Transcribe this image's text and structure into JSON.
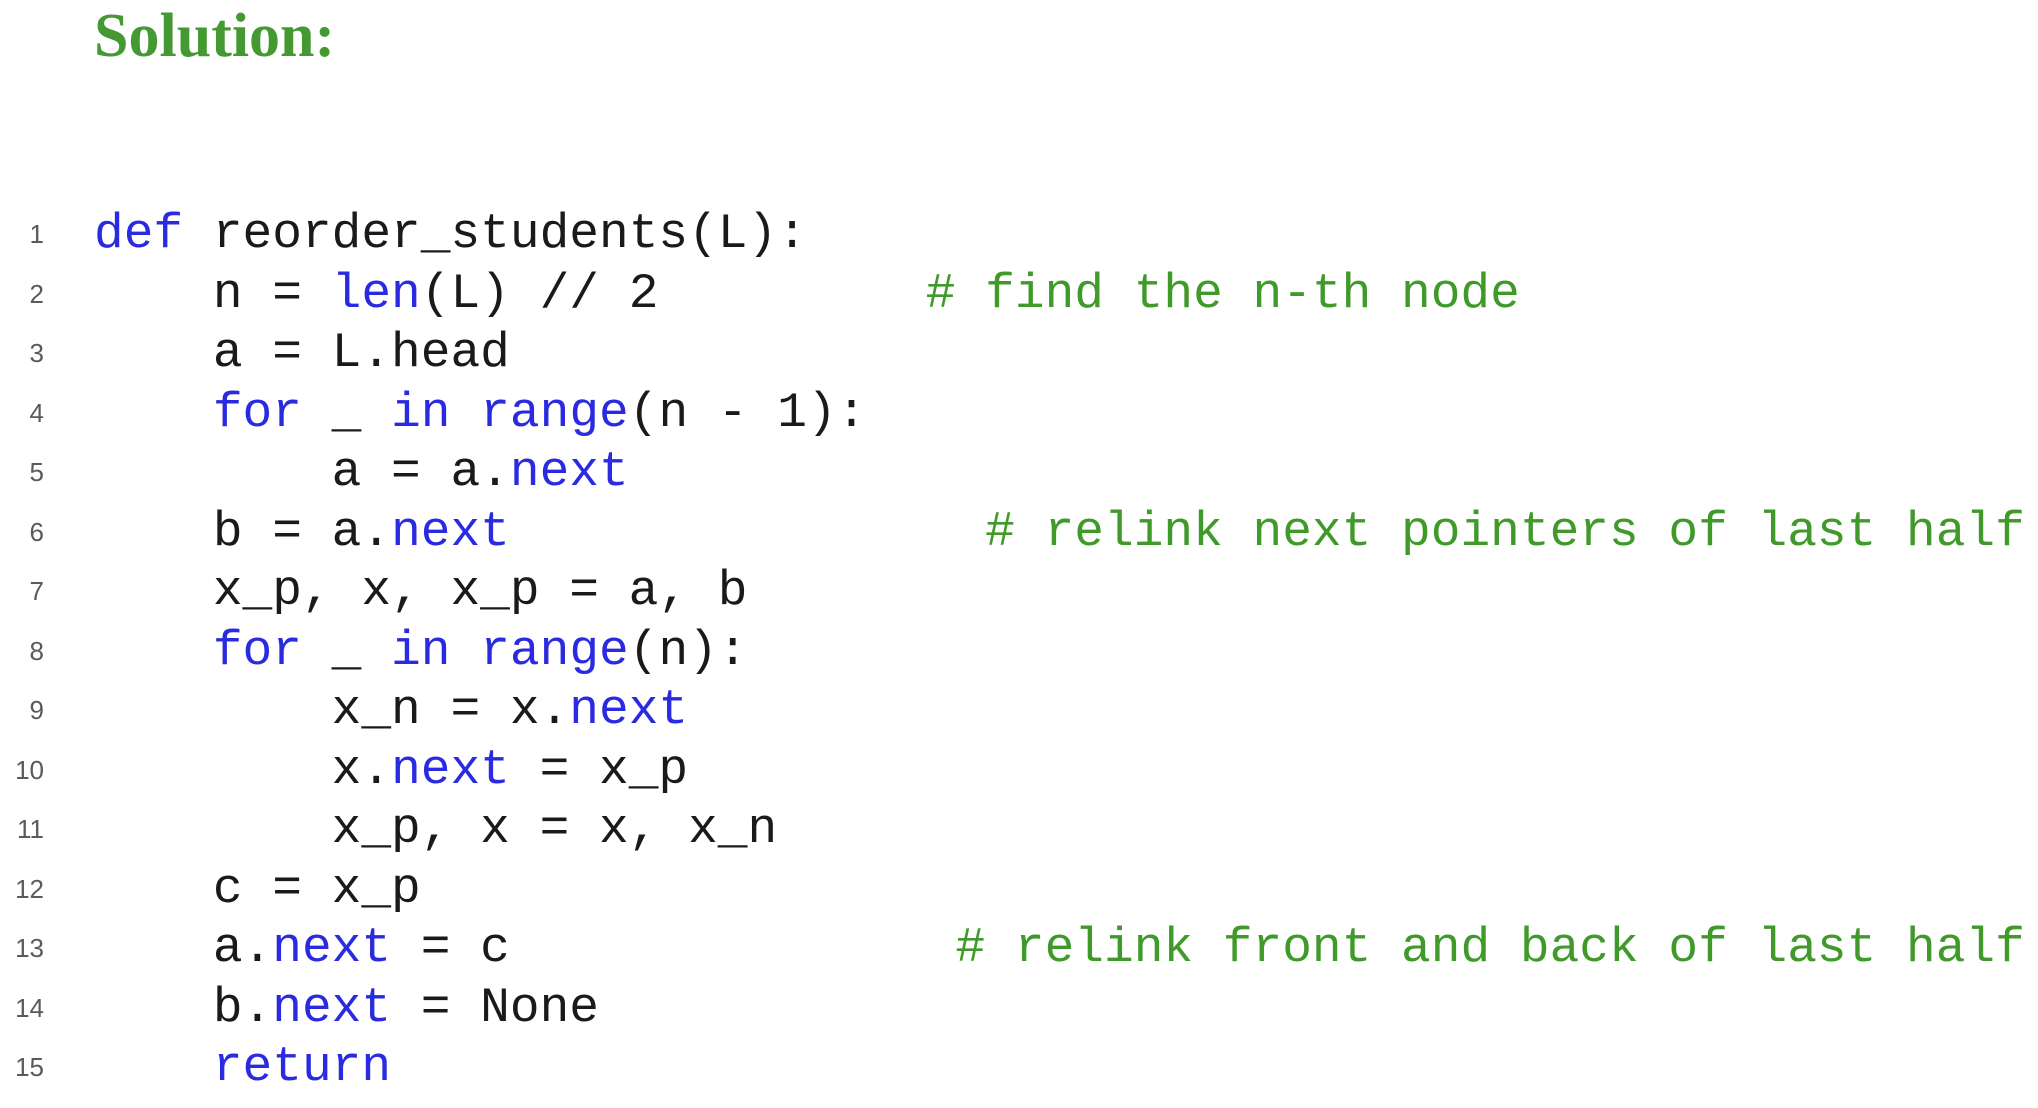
{
  "heading": "Solution:",
  "colors": {
    "heading": "#449933",
    "keyword": "#2a2ae0",
    "comment": "#3f9a2a",
    "text": "#1a1a1a",
    "line_number": "#5a5a5a"
  },
  "code": [
    {
      "n": "1",
      "tokens": [
        {
          "t": "def",
          "k": "kw"
        },
        {
          "t": " reorder_students(L):",
          "k": "tx"
        }
      ]
    },
    {
      "n": "2",
      "tokens": [
        {
          "t": "    n = ",
          "k": "tx"
        },
        {
          "t": "len",
          "k": "kw"
        },
        {
          "t": "(L) // 2         ",
          "k": "tx"
        },
        {
          "t": "# find the n-th node",
          "k": "cm"
        }
      ]
    },
    {
      "n": "3",
      "tokens": [
        {
          "t": "    a = L.head",
          "k": "tx"
        }
      ]
    },
    {
      "n": "4",
      "tokens": [
        {
          "t": "    ",
          "k": "tx"
        },
        {
          "t": "for",
          "k": "kw"
        },
        {
          "t": " _ ",
          "k": "tx"
        },
        {
          "t": "in",
          "k": "kw"
        },
        {
          "t": " ",
          "k": "tx"
        },
        {
          "t": "range",
          "k": "kw"
        },
        {
          "t": "(n - 1):",
          "k": "tx"
        }
      ]
    },
    {
      "n": "5",
      "tokens": [
        {
          "t": "        a = a.",
          "k": "tx"
        },
        {
          "t": "next",
          "k": "kw"
        }
      ]
    },
    {
      "n": "6",
      "tokens": [
        {
          "t": "    b = a.",
          "k": "tx"
        },
        {
          "t": "next",
          "k": "kw"
        },
        {
          "t": "                ",
          "k": "tx"
        },
        {
          "t": "# relink next pointers of last half",
          "k": "cm"
        }
      ]
    },
    {
      "n": "7",
      "tokens": [
        {
          "t": "    x_p, x, x_p = a, b",
          "k": "tx"
        }
      ]
    },
    {
      "n": "8",
      "tokens": [
        {
          "t": "    ",
          "k": "tx"
        },
        {
          "t": "for",
          "k": "kw"
        },
        {
          "t": " _ ",
          "k": "tx"
        },
        {
          "t": "in",
          "k": "kw"
        },
        {
          "t": " ",
          "k": "tx"
        },
        {
          "t": "range",
          "k": "kw"
        },
        {
          "t": "(n):",
          "k": "tx"
        }
      ]
    },
    {
      "n": "9",
      "tokens": [
        {
          "t": "        x_n = x.",
          "k": "tx"
        },
        {
          "t": "next",
          "k": "kw"
        }
      ]
    },
    {
      "n": "10",
      "tokens": [
        {
          "t": "        x.",
          "k": "tx"
        },
        {
          "t": "next",
          "k": "kw"
        },
        {
          "t": " = x_p",
          "k": "tx"
        }
      ]
    },
    {
      "n": "11",
      "tokens": [
        {
          "t": "        x_p, x = x, x_n",
          "k": "tx"
        }
      ]
    },
    {
      "n": "12",
      "tokens": [
        {
          "t": "    c = x_p",
          "k": "tx"
        }
      ]
    },
    {
      "n": "13",
      "tokens": [
        {
          "t": "    a.",
          "k": "tx"
        },
        {
          "t": "next",
          "k": "kw"
        },
        {
          "t": " = c               ",
          "k": "tx"
        },
        {
          "t": "# relink front and back of last half",
          "k": "cm"
        }
      ]
    },
    {
      "n": "14",
      "tokens": [
        {
          "t": "    b.",
          "k": "tx"
        },
        {
          "t": "next",
          "k": "kw"
        },
        {
          "t": " = None",
          "k": "tx"
        }
      ]
    },
    {
      "n": "15",
      "tokens": [
        {
          "t": "    ",
          "k": "tx"
        },
        {
          "t": "return",
          "k": "kw"
        }
      ]
    }
  ]
}
